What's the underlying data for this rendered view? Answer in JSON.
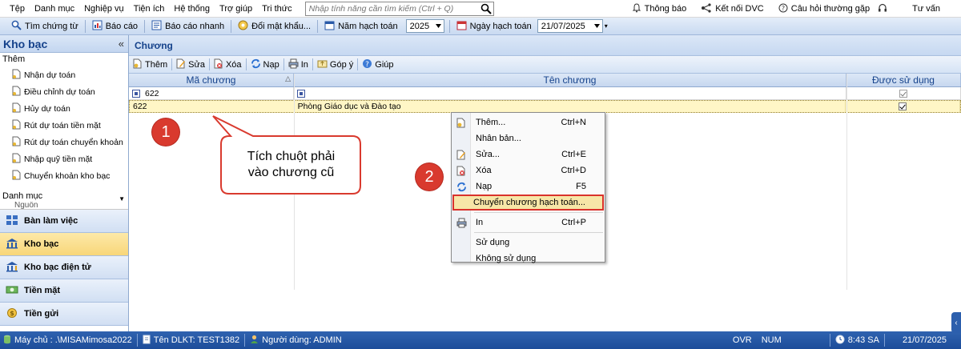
{
  "menu": {
    "items": [
      "Tệp",
      "Danh mục",
      "Nghiệp vụ",
      "Tiện ích",
      "Hệ thống",
      "Trợ giúp",
      "Tri thức"
    ],
    "search_placeholder": "Nhập tính năng cần tìm kiếm (Ctrl + Q)",
    "right": {
      "notify": "Thông báo",
      "connect": "Kết nối DVC",
      "faq": "Câu hỏi thường gặp",
      "consult": "Tư vấn"
    }
  },
  "toolbar": {
    "find": "Tìm chứng từ",
    "report": "Báo cáo",
    "quick_report": "Báo cáo nhanh",
    "change_pwd": "Đổi mật khẩu...",
    "fiscal_year_label": "Năm hạch toán",
    "fiscal_year": "2025",
    "date_label": "Ngày hạch toán",
    "date": "21/07/2025"
  },
  "left_panel": {
    "title": "Kho bạc",
    "group_them": "Thêm",
    "items": [
      "Nhận dự toán",
      "Điều chỉnh dự toán",
      "Hủy dự toán",
      "Rút dự toán tiền mặt",
      "Rút dự toán chuyển khoản",
      "Nhập quỹ tiền mặt",
      "Chuyển khoản kho bạc"
    ],
    "group_danhmuc": "Danh mục",
    "danhmuc_cut": "Nguồn",
    "nav": [
      "Bàn làm việc",
      "Kho bạc",
      "Kho bạc điện tử",
      "Tiền mặt",
      "Tiền gửi"
    ]
  },
  "main": {
    "title": "Chương",
    "toolbar": [
      "Thêm",
      "Sửa",
      "Xóa",
      "Nạp",
      "In",
      "Góp ý",
      "Giúp"
    ],
    "columns": [
      "Mã chương",
      "Tên chương",
      "Được sử dụng"
    ],
    "filter_row": {
      "code": "622"
    },
    "rows": [
      {
        "code": "622",
        "name": "Phòng Giáo dục và Đào tạo",
        "used": true
      }
    ]
  },
  "context_menu": {
    "items": [
      {
        "label": "Thêm...",
        "shortcut": "Ctrl+N"
      },
      {
        "label": "Nhân bản...",
        "shortcut": ""
      },
      {
        "label": "Sửa...",
        "shortcut": "Ctrl+E"
      },
      {
        "label": "Xóa",
        "shortcut": "Ctrl+D"
      },
      {
        "label": "Nạp",
        "shortcut": "F5"
      },
      {
        "label": "Chuyển chương hạch toán...",
        "shortcut": ""
      },
      {
        "label": "In",
        "shortcut": "Ctrl+P"
      },
      {
        "label": "Sử dụng",
        "shortcut": ""
      },
      {
        "label": "Không sử dụng",
        "shortcut": ""
      }
    ]
  },
  "annotations": {
    "badge1": "1",
    "badge2": "2",
    "callout_line1": "Tích chuột phải",
    "callout_line2": "vào chương cũ"
  },
  "status": {
    "server": "Máy chủ : .\\MISAMimosa2022",
    "db": "Tên DLKT: TEST1382",
    "user": "Người dùng: ADMIN",
    "ovr": "OVR",
    "num": "NUM",
    "time": "8:43 SA",
    "date": "21/07/2025"
  },
  "colors": {
    "accent_red": "#d93a2e",
    "status_blue": "#1d4d9a",
    "selected_row": "#fff6c6",
    "highlight_item": "#f7e6a7"
  }
}
